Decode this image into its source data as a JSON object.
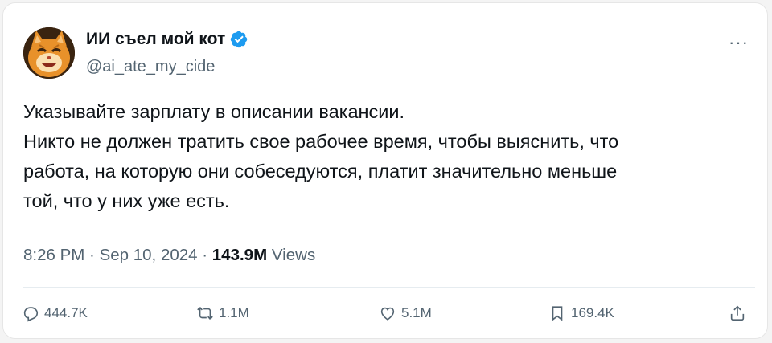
{
  "author": {
    "name": "ИИ съел мой кот",
    "handle": "@ai_ate_my_cide",
    "verified": true,
    "avatar_icon": "orange-cat-avatar"
  },
  "more_label": "···",
  "tweet": {
    "lines": [
      "Указывайте зарплату в описании вакансии.",
      "Никто не должен тратить свое рабочее время, чтобы выяснить, что",
      "работа, на которую они собеседуются, платит значительно меньше",
      "той, что у них уже есть."
    ]
  },
  "meta": {
    "time": "8:26 PM",
    "separator": " · ",
    "date": "Sep 10, 2024",
    "views_count": "143.9M",
    "views_label": "Views"
  },
  "actions": {
    "replies": "444.7K",
    "retweets": "1.1M",
    "likes": "5.1M",
    "bookmarks": "169.4K"
  },
  "colors": {
    "text": "#0f1419",
    "secondary": "#536471",
    "verified": "#1d9bf0"
  }
}
